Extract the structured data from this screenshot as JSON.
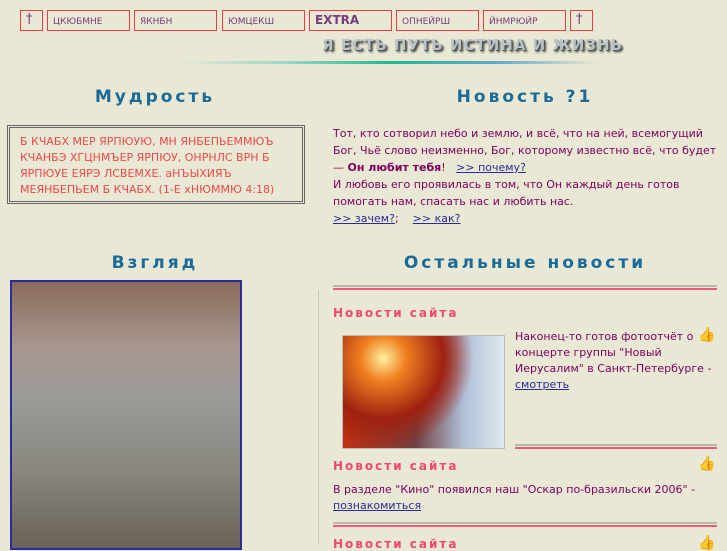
{
  "nav": {
    "items": [
      "†",
      "ЦКЮБМНЕ",
      "ЯКНБН",
      "ЮМЦЕКШ",
      "EXTRA",
      "ОПНЕЙРШ",
      "ЙНМРЮЙР",
      "†"
    ]
  },
  "banner": "Я ЕСТЬ ПУТЬ ИСТИНА И ЖИЗНЬ",
  "wisdom": {
    "title": "Мудрость",
    "quote": "Б КЧАБХ МЕР ЯРПЮУЮ, МН ЯНБЕПЬЕММЮЪ КЧАНБЭ ХГЦНМЪЕР ЯРПЮУ, ОНРНЛС ВРН Б ЯРПЮУЕ ЕЯРЭ ЛСВЕМХЕ. аНЪЫХИЯЪ МЕЯНБЕПЬЕМ Б КЧАБХ. (1-Е хНЮММЮ 4:18)"
  },
  "news1": {
    "title": "Новость ?1",
    "p1": "Тот, кто сотворил небо и землю, и всё, что на ней, всемогущий Бог, Чьё слово неизменно, Бог, которому известно всё, что будет — ",
    "bold": "Он любит тебя",
    "excl": "!",
    "link1": ">> почему?",
    "p2": "И любовь его проявилась в том, что Он каждый день готов помогать нам, спасать нас и любить нас.",
    "link2": ">> зачем?",
    "sep": ";",
    "link3": ">> как?"
  },
  "view": {
    "title": "Взгляд"
  },
  "other": {
    "title": "Остальные новости",
    "items": [
      {
        "heading": "Новости сайта",
        "text": "Наконец-то готов фотоотчёт о концерте группы \"Новый Иерусалим\" в Санкт-Петербурге - ",
        "link": "смотреть"
      },
      {
        "heading": "Новости сайта",
        "text": "В разделе \"Кино\" появился наш \"Оскар по-бразильски 2006\" - ",
        "link": "познакомиться"
      },
      {
        "heading": "Новости сайта"
      }
    ]
  }
}
